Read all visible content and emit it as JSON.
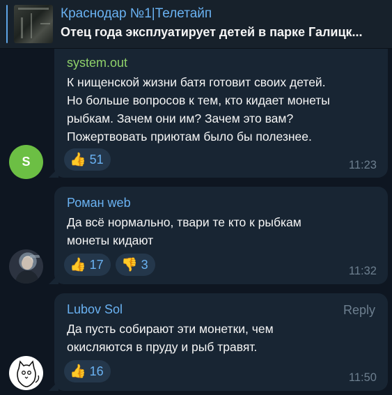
{
  "pinned": {
    "title": "Краснодар №1|Телетайп",
    "text": "Отец года эксплуатирует детей в парке Галицк..."
  },
  "messages": [
    {
      "author": "system.out",
      "author_color": "#8fd16a",
      "avatar_letter": "S",
      "text_lines": [
        "К нищенской жизни батя готовит своих детей.",
        "Но больше вопросов к тем, кто кидает монеты",
        "рыбкам. Зачем они им? Зачем это вам?",
        "Пожертвовать приютам было бы полезнее."
      ],
      "reactions": [
        {
          "emoji": "👍",
          "count": "51"
        }
      ],
      "time": "11:23"
    },
    {
      "author": "Роман web",
      "author_color": "#6ab2f2",
      "avatar_icon": "user-photo",
      "text_lines": [
        "Да всё нормально, твари те кто к рыбкам",
        "монеты кидают"
      ],
      "reactions": [
        {
          "emoji": "👍",
          "count": "17"
        },
        {
          "emoji": "👎",
          "count": "3"
        }
      ],
      "time": "11:32"
    },
    {
      "author": "Lubov Sol",
      "author_color": "#6ab2f2",
      "avatar_icon": "cat-drawing",
      "reply_label": "Reply",
      "text_lines": [
        "Да пусть собирают эти монетки, чем",
        "окисляются в пруду и рыб травят."
      ],
      "reactions": [
        {
          "emoji": "👍",
          "count": "16"
        }
      ],
      "time": "11:50"
    }
  ]
}
